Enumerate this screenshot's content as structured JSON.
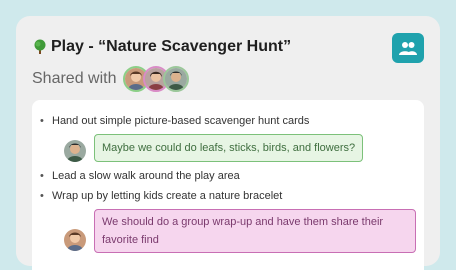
{
  "header": {
    "title": "Play - “Nature Scavenger Hunt”",
    "shared_label": "Shared with",
    "tree_icon": "tree-icon",
    "people_icon": "people-icon"
  },
  "colors": {
    "accent": "#1fa2ad",
    "green_bubble_bg": "#e7f5e4",
    "green_bubble_border": "#7cc17a",
    "pink_bubble_bg": "#f6d6ee",
    "pink_bubble_border": "#c86fb4"
  },
  "items": [
    "Hand out simple picture-based scavenger hunt cards",
    "Lead a slow walk around the play area",
    "Wrap up by letting kids create a nature bracelet"
  ],
  "comments": [
    {
      "text": "Maybe we could do leafs, sticks, birds, and flowers?"
    },
    {
      "text": "We should do a group wrap-up and have them share their favorite find"
    }
  ]
}
